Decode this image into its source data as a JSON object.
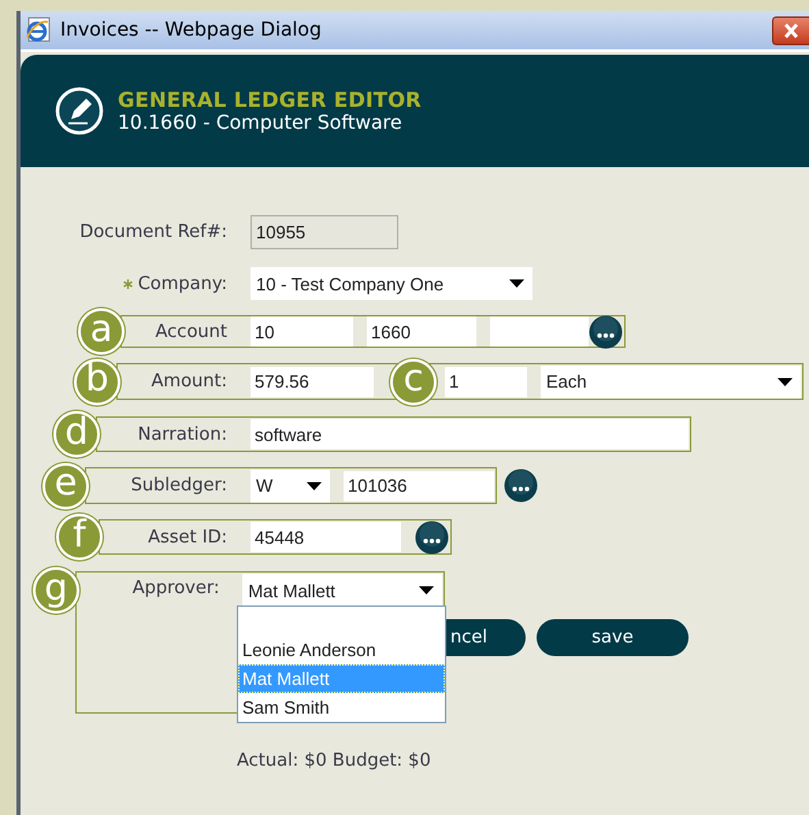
{
  "window": {
    "title": "Invoices -- Webpage Dialog"
  },
  "header": {
    "title": "GENERAL LEDGER EDITOR",
    "subtitle": "10.1660 - Computer Software"
  },
  "rows": [
    {
      "label": "Document Ref#:",
      "controls": [
        {
          "kind": "readonly",
          "value": "10955"
        }
      ]
    },
    {
      "label": "Company:",
      "required": true,
      "controls": [
        {
          "kind": "select",
          "value": "10 - Test Company One"
        }
      ]
    },
    {
      "label": "Account",
      "callout": "a",
      "controls": [
        {
          "kind": "text",
          "value": "10"
        },
        {
          "kind": "text",
          "value": "1660"
        },
        {
          "kind": "text"
        },
        {
          "kind": "lookup"
        }
      ]
    },
    {
      "label": "Amount:",
      "callout": "b",
      "controls": [
        {
          "kind": "text",
          "value": "579.56"
        },
        {
          "kind": "callout",
          "value": "c"
        },
        {
          "kind": "text",
          "value": "1"
        },
        {
          "kind": "select",
          "value": "Each"
        }
      ]
    },
    {
      "label": "Narration:",
      "callout": "d",
      "controls": [
        {
          "kind": "text",
          "value": "software"
        }
      ]
    },
    {
      "label": "Subledger:",
      "callout": "e",
      "controls": [
        {
          "kind": "select",
          "value": "W"
        },
        {
          "kind": "text",
          "value": "101036"
        }
      ],
      "after": [
        {
          "kind": "lookup"
        }
      ]
    },
    {
      "label": "Asset ID:",
      "callout": "f",
      "controls": [
        {
          "kind": "text",
          "value": "45448"
        },
        {
          "kind": "lookup"
        }
      ]
    },
    {
      "label": "Approver:",
      "callout": "g",
      "controls": [
        {
          "kind": "select",
          "value": "Mat Mallett",
          "expanded": true,
          "options": [
            {
              "label": "Leonie Anderson",
              "selected": false
            },
            {
              "label": "Mat Mallett",
              "selected": true
            },
            {
              "label": "Sam Smith",
              "selected": false
            }
          ]
        }
      ]
    }
  ],
  "buttons": [
    {
      "label": "ncel"
    },
    {
      "label": "save"
    }
  ],
  "footer": "Actual: $0 Budget: $0"
}
